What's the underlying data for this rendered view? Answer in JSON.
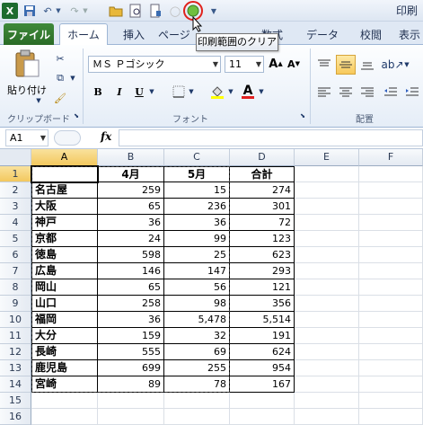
{
  "window": {
    "title": "印刷"
  },
  "qat": {
    "tooltip": "印刷範囲のクリア",
    "icons": [
      "excel-logo-icon",
      "save-icon",
      "undo-icon",
      "redo-icon",
      "open-folder-icon",
      "print-preview-icon",
      "print-icon",
      "clear-print-area-icon",
      "customize-qat-icon"
    ]
  },
  "tabs": [
    "ファイル",
    "ホーム",
    "挿入",
    "ページ",
    "数式",
    "データ",
    "校閲",
    "表示"
  ],
  "ribbon": {
    "paste_label": "貼り付け",
    "clipboard_label": "クリップボード",
    "font_label": "フォント",
    "alignment_label": "配置",
    "font_name": "ＭＳ Ｐゴシック",
    "font_size": "11",
    "bold": "B",
    "italic": "I",
    "underline": "U"
  },
  "formula_bar": {
    "name_box": "A1",
    "fx": "fx",
    "content": ""
  },
  "columns": [
    "A",
    "B",
    "C",
    "D",
    "E",
    "F"
  ],
  "rows": [
    {
      "num": "1",
      "a": "",
      "b": "4月",
      "c": "5月",
      "d": "合計"
    },
    {
      "num": "2",
      "a": "名古屋",
      "b": "259",
      "c": "15",
      "d": "274"
    },
    {
      "num": "3",
      "a": "大阪",
      "b": "65",
      "c": "236",
      "d": "301"
    },
    {
      "num": "4",
      "a": "神戸",
      "b": "36",
      "c": "36",
      "d": "72"
    },
    {
      "num": "5",
      "a": "京都",
      "b": "24",
      "c": "99",
      "d": "123"
    },
    {
      "num": "6",
      "a": "徳島",
      "b": "598",
      "c": "25",
      "d": "623"
    },
    {
      "num": "7",
      "a": "広島",
      "b": "146",
      "c": "147",
      "d": "293"
    },
    {
      "num": "8",
      "a": "岡山",
      "b": "65",
      "c": "56",
      "d": "121"
    },
    {
      "num": "9",
      "a": "山口",
      "b": "258",
      "c": "98",
      "d": "356"
    },
    {
      "num": "10",
      "a": "福岡",
      "b": "36",
      "c": "5,478",
      "d": "5,514"
    },
    {
      "num": "11",
      "a": "大分",
      "b": "159",
      "c": "32",
      "d": "191"
    },
    {
      "num": "12",
      "a": "長崎",
      "b": "555",
      "c": "69",
      "d": "624"
    },
    {
      "num": "13",
      "a": "鹿児島",
      "b": "699",
      "c": "255",
      "d": "954"
    },
    {
      "num": "14",
      "a": "宮崎",
      "b": "89",
      "c": "78",
      "d": "167"
    },
    {
      "num": "15",
      "a": "",
      "b": "",
      "c": "",
      "d": ""
    },
    {
      "num": "16",
      "a": "",
      "b": "",
      "c": "",
      "d": ""
    }
  ]
}
